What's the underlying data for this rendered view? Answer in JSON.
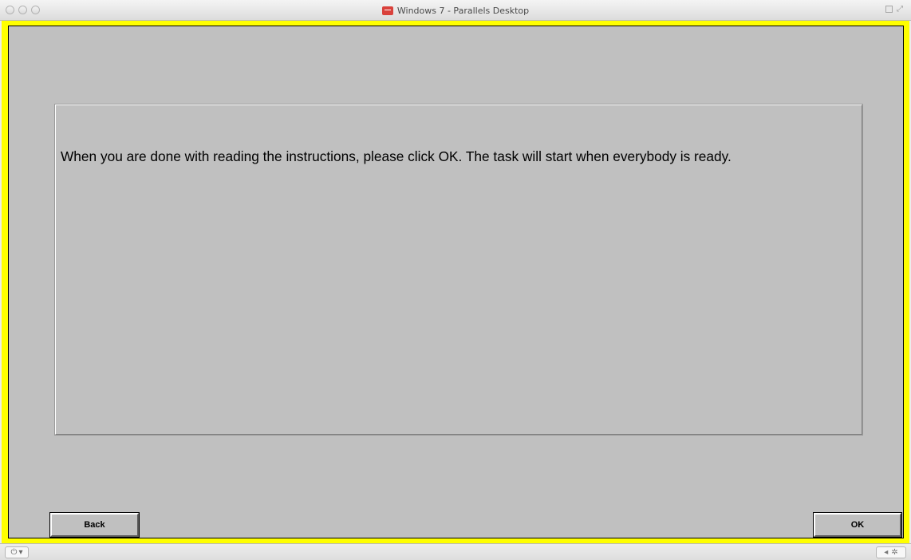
{
  "window": {
    "title": "Windows 7 - Parallels Desktop",
    "app_icon": "parallels-monitor-icon",
    "frame_color": "#ffff00",
    "surface_color": "#c0c0c0"
  },
  "instructions": {
    "text": "When you are done with reading the instructions, please click OK. The task will start when everybody is ready."
  },
  "buttons": {
    "back_label": "Back",
    "ok_label": "OK"
  },
  "statusbar": {
    "power_icon": "⏻",
    "power_caret": "▾",
    "arrow_icon": "◂",
    "gear_icon": "✲"
  }
}
